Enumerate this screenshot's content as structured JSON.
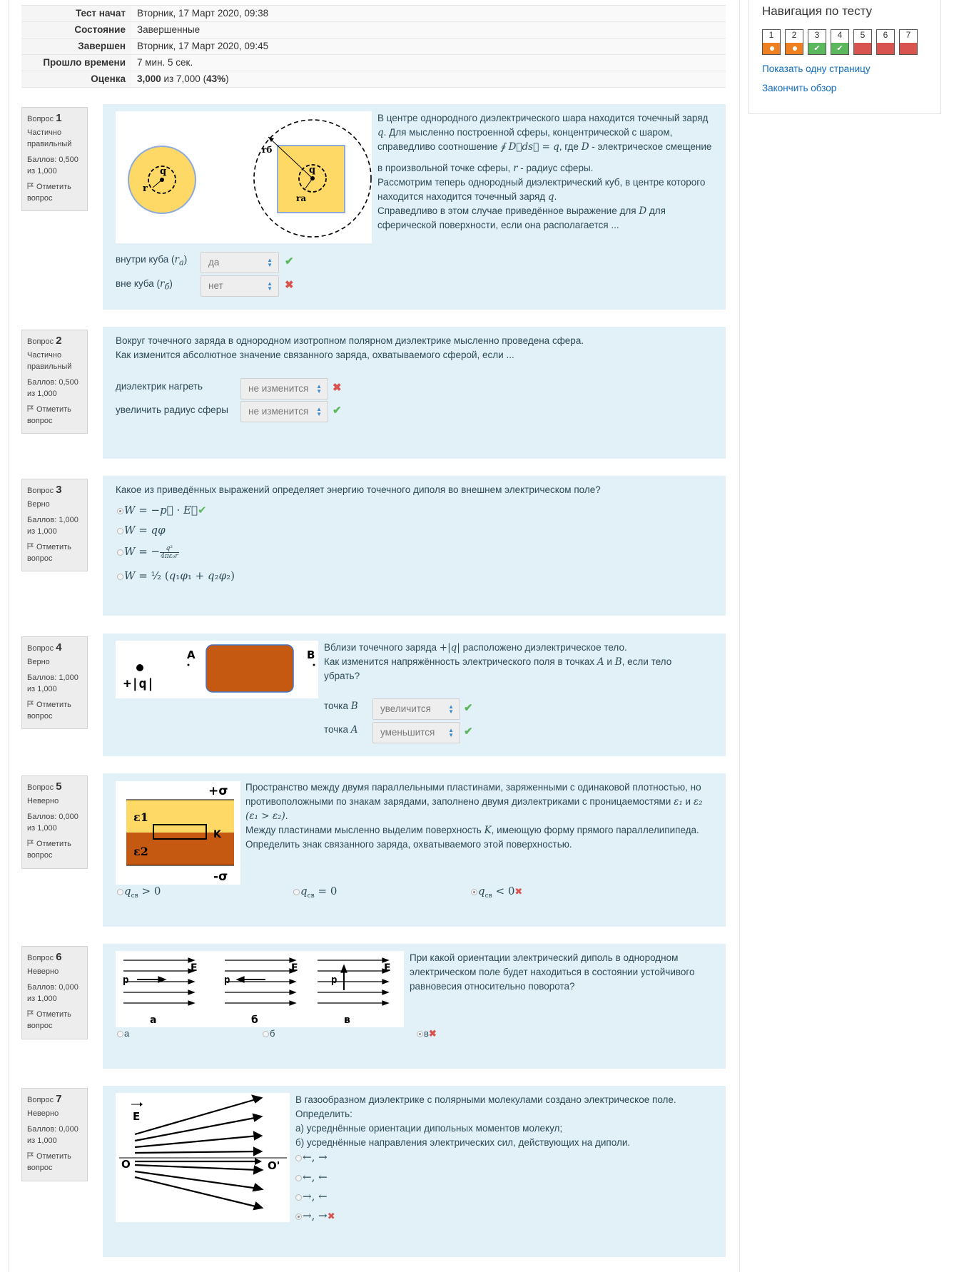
{
  "summary": [
    {
      "key": "Тест начат",
      "value": "Вторник, 17 Март 2020, 09:38"
    },
    {
      "key": "Состояние",
      "value": "Завершенные"
    },
    {
      "key": "Завершен",
      "value": "Вторник, 17 Март 2020, 09:45"
    },
    {
      "key": "Прошло времени",
      "value": "7 мин. 5 сек."
    },
    {
      "key": "Оценка",
      "value_bold": "3,000",
      "value_mid": " из 7,000 (",
      "value_pct": "43%",
      "value_end": ")"
    }
  ],
  "questions": [
    {
      "label": "Вопрос",
      "num": "1",
      "status": "Частично правильный",
      "grade": "Баллов: 0,500 из 1,000",
      "flag": "Отметить вопрос"
    },
    {
      "label": "Вопрос",
      "num": "2",
      "status": "Частично правильный",
      "grade": "Баллов: 0,500 из 1,000",
      "flag": "Отметить вопрос"
    },
    {
      "label": "Вопрос",
      "num": "3",
      "status": "Верно",
      "grade": "Баллов: 1,000 из 1,000",
      "flag": "Отметить вопрос"
    },
    {
      "label": "Вопрос",
      "num": "4",
      "status": "Верно",
      "grade": "Баллов: 1,000 из 1,000",
      "flag": "Отметить вопрос"
    },
    {
      "label": "Вопрос",
      "num": "5",
      "status": "Неверно",
      "grade": "Баллов: 0,000 из 1,000",
      "flag": "Отметить вопрос"
    },
    {
      "label": "Вопрос",
      "num": "6",
      "status": "Неверно",
      "grade": "Баллов: 0,000 из 1,000",
      "flag": "Отметить вопрос"
    },
    {
      "label": "Вопрос",
      "num": "7",
      "status": "Неверно",
      "grade": "Баллов: 0,000 из 1,000",
      "flag": "Отметить вопрос"
    }
  ],
  "q1": {
    "text1": "В центре однородного диэлектрического шара находится точечный заряд",
    "text2": ". Для мысленно построенной сферы, концентрической с шаром,",
    "text3": "справедливо соотношение",
    "text4": ", где",
    "text5": " - электрическое смещение",
    "text6": "в произвольной точке сферы,",
    "text7": " - радиус сферы.",
    "text8": "Рассмотрим теперь однородный диэлектрический куб, в центре которого",
    "text9": "находится находится точечный заряд",
    "text10": "Справедливо в этом случае приведённое выражение для",
    "text11": " для",
    "text12": "сферической поверхности, если она располагается ...",
    "sub1": "внутри куба",
    "sub2": "вне куба",
    "ans1": "да",
    "ans2": "нет",
    "img_r": "r",
    "img_q": "q",
    "img_rb": "rб",
    "img_ra": "rа"
  },
  "q2": {
    "text1": "Вокруг точечного заряда в однородном изотропном полярном диэлектрике мысленно проведена сфера.",
    "text2": "Как изменится абсолютное значение связанного заряда, охватываемого сферой, если ...",
    "sub1": "диэлектрик нагреть",
    "sub2": "увеличить радиус сферы",
    "ans1": "не изменится",
    "ans2": "не изменится"
  },
  "q3": {
    "text": "Какое из приведённых выражений определяет энергию точечного диполя во внешнем электрическом поле?"
  },
  "q4": {
    "text1": "Вблизи точечного заряда",
    "text2": "расположено диэлектрическое тело.",
    "text3": "Как изменится напряжённость электрического поля в точках",
    "text4": "и",
    "text5": ", если тело",
    "text6": "убрать?",
    "sub1": "точка",
    "sub2": "точка",
    "ans1": "увеличится",
    "ans2": "уменьшится",
    "img_q": "+|q|",
    "img_a": "A",
    "img_b": "B"
  },
  "q5": {
    "text1": "Пространство между двумя параллельными пластинами, заряженными с одинаковой плотностью, но",
    "text2": "противоположными по знакам зарядами, заполнено двумя диэлектриками с проницаемостями",
    "text3": "Между пластинами мысленно выделим поверхность",
    "text4": ", имеющую форму прямого параллелипипеда.",
    "text5": "Определить знак связанного заряда, охватываемого этой поверхностью.",
    "img_plus": "+σ",
    "img_minus": "-σ",
    "img_e1": "ε1",
    "img_e2": "ε2",
    "img_k": "K"
  },
  "q6": {
    "text1": "При какой ориентации электрический диполь в однородном",
    "text2": "электрическом поле будет находиться в состоянии устойчивого",
    "text3": "равновесия относительно поворота?",
    "opt_a": "а",
    "opt_b": "б",
    "opt_c": "в",
    "img_p": "p",
    "img_e": "E"
  },
  "q7": {
    "text1": "В газообразном диэлектрике с полярными молекулами создано электрическое поле.",
    "text2": "Определить:",
    "text3": "а) усреднённые ориентации дипольных моментов молекул;",
    "text4": "б) усреднённые направления электрических сил, действующих на диполи.",
    "opt1": "←, →",
    "opt2": "←, ←",
    "opt3": "→, ←",
    "opt4": "→, →",
    "img_e": "E",
    "img_o": "O",
    "img_o2": "O'"
  },
  "nav": {
    "title": "Навигация по тесту",
    "buttons": [
      {
        "n": "1",
        "state": "partial"
      },
      {
        "n": "2",
        "state": "partial"
      },
      {
        "n": "3",
        "state": "correct"
      },
      {
        "n": "4",
        "state": "correct"
      },
      {
        "n": "5",
        "state": "wrong"
      },
      {
        "n": "6",
        "state": "wrong"
      },
      {
        "n": "7",
        "state": "wrong"
      }
    ],
    "link1": "Показать одну страницу",
    "link2": "Закончить обзор"
  },
  "colors": {
    "content_bg": "#e2f1f7",
    "partial": "#f0801f",
    "correct": "#5cb85c",
    "wrong": "#d9534f",
    "link": "#0f6cbf",
    "ball_fill": "#ffd966",
    "dielectric_orange": "#c65911"
  }
}
